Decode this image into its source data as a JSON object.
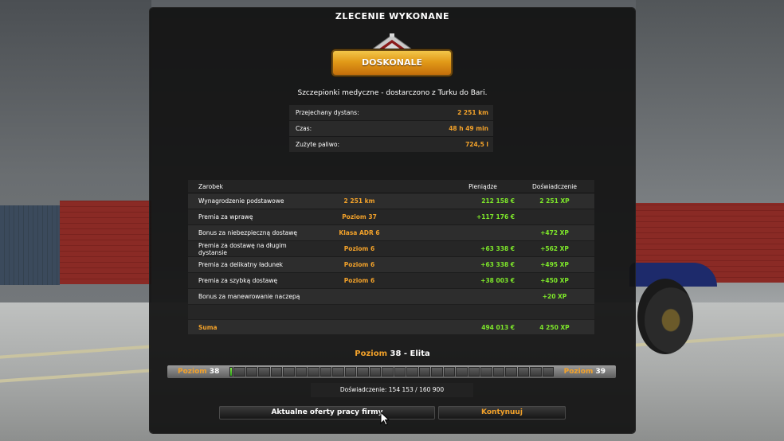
{
  "title": "ZLECENIE WYKONANE",
  "rating_badge": "DOSKONALE",
  "delivery_summary": "Szczepionki medyczne - dostarczono z Turku do Bari.",
  "stats": [
    {
      "label": "Przejechany dystans:",
      "value": "2 251 km"
    },
    {
      "label": "Czas:",
      "value": "48 h 49 min"
    },
    {
      "label": "Zużyte paliwo:",
      "value": "724,5 l"
    }
  ],
  "earnings": {
    "headers": {
      "category": "Zarobek",
      "money": "Pieniądze",
      "experience": "Doświadczenie"
    },
    "rows": [
      {
        "label": "Wynagrodzenie podstawowe",
        "detail": "2 251 km",
        "money": "212 158 €",
        "xp": "2 251 XP"
      },
      {
        "label": "Premia za wprawę",
        "detail": "Poziom 37",
        "money": "+117 176 €",
        "xp": ""
      },
      {
        "label": "Bonus za niebezpieczną dostawę",
        "detail": "Klasa ADR 6",
        "money": "",
        "xp": "+472 XP"
      },
      {
        "label": "Premia za dostawę na długim dystansie",
        "detail": "Poziom 6",
        "money": "+63 338 €",
        "xp": "+562 XP"
      },
      {
        "label": "Premia za delikatny ładunek",
        "detail": "Poziom 6",
        "money": "+63 338 €",
        "xp": "+495 XP"
      },
      {
        "label": "Premia za szybką dostawę",
        "detail": "Poziom 6",
        "money": "+38 003 €",
        "xp": "+450 XP"
      },
      {
        "label": "Bonus za manewrowanie naczepą",
        "detail": "",
        "money": "",
        "xp": "+20 XP"
      }
    ],
    "sum": {
      "label": "Suma",
      "money": "494 013 €",
      "xp": "4 250 XP"
    }
  },
  "level": {
    "title_prefix": "Poziom",
    "current": "38",
    "rank": "- Elita",
    "left_label": "Poziom",
    "left_value": "38",
    "right_label": "Poziom",
    "right_value": "39",
    "progress_fraction": 0.02,
    "experience_text": "Doświadczenie: 154 153 / 160 900"
  },
  "buttons": {
    "offers": "Aktualne oferty pracy firmy",
    "continue": "Kontynuuj"
  },
  "colors": {
    "accent": "#f3a22a",
    "xp_green": "#7ee82a",
    "panel": "#121212"
  }
}
